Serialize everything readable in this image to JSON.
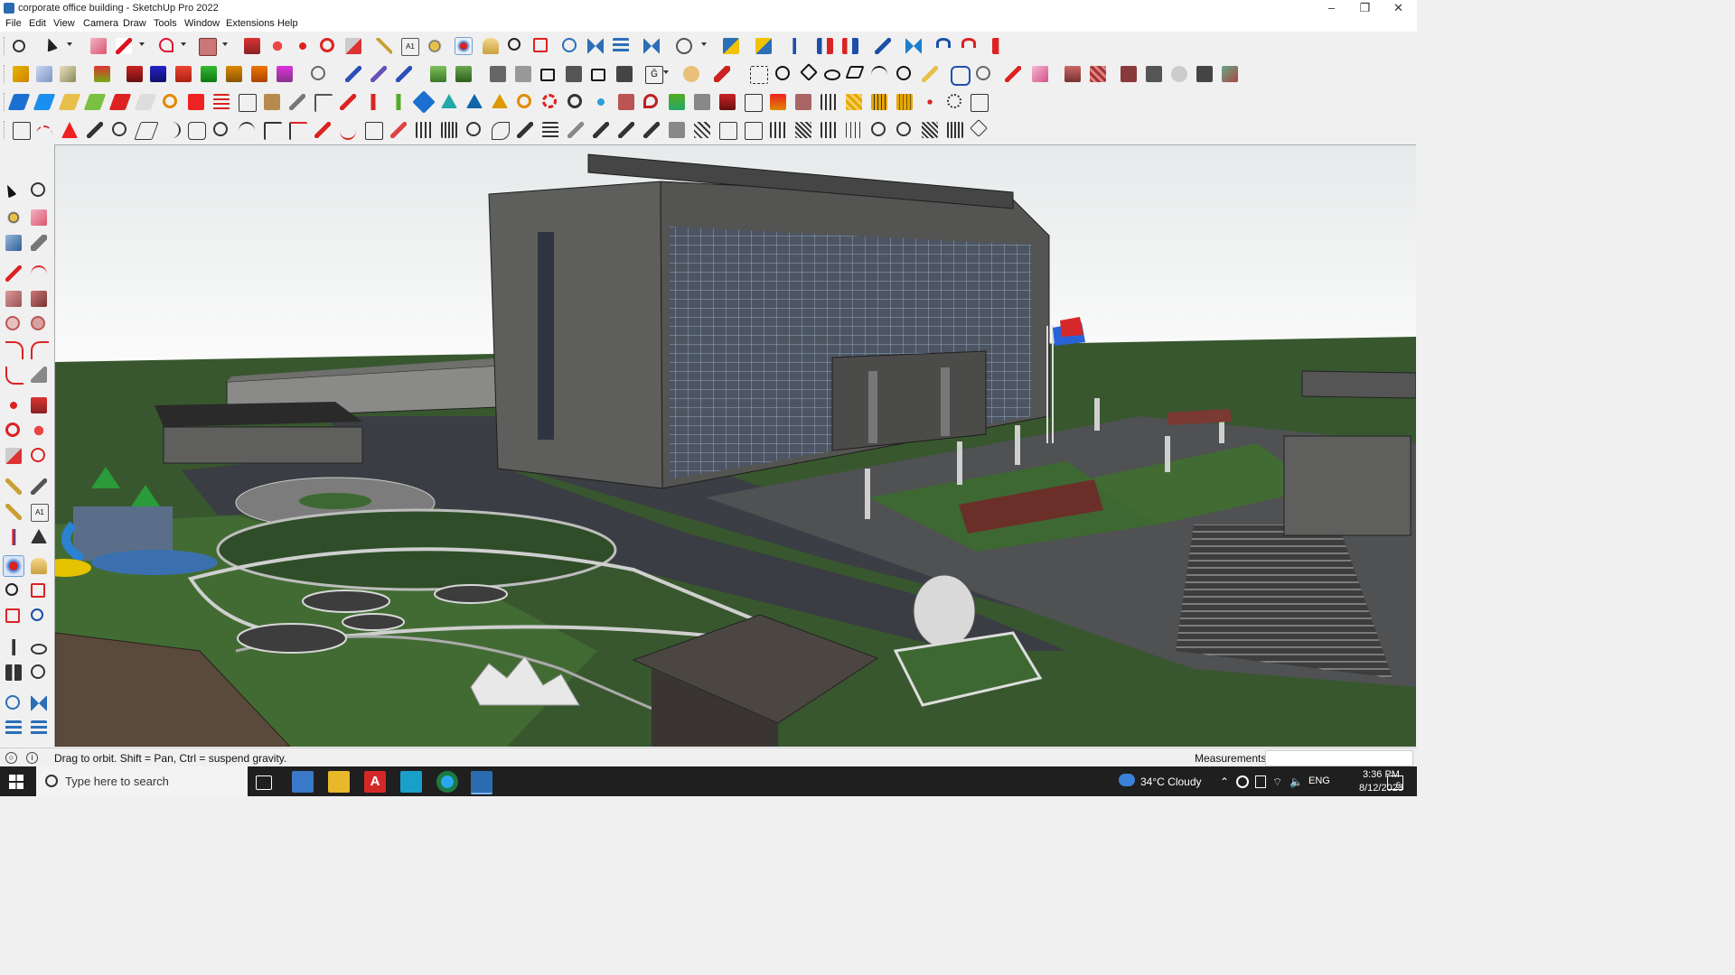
{
  "window": {
    "title": "corporate office building - SketchUp Pro 2022",
    "minimize": "–",
    "maximize": "❐",
    "close": "✕"
  },
  "menu": [
    "File",
    "Edit",
    "View",
    "Camera",
    "Draw",
    "Tools",
    "Window",
    "Extensions",
    "Help"
  ],
  "status": {
    "hint": "Drag to orbit. Shift = Pan, Ctrl = suspend gravity.",
    "measurements_label": "Measurements",
    "measurements_value": ""
  },
  "taskbar": {
    "search_placeholder": "Type here to search",
    "weather": "34°C  Cloudy",
    "language": "ENG",
    "time": "3:36 PM",
    "date": "8/12/2023",
    "notification_count": "5"
  },
  "colors": {
    "sky_top": "#e6eaea",
    "grass": "#3a5a30",
    "road": "#3b3e44",
    "building": "#5e5e5c",
    "flag_red": "#d62828",
    "flag_blue": "#2a62d8",
    "toolbar_bg": "#f0f0f0",
    "taskbar_bg": "#1f1f1f"
  },
  "icons": {
    "toolbar_row1": [
      "zoom-window-icon",
      "select-icon",
      "eraser-icon",
      "line-icon",
      "freehand-arc-icon",
      "rectangle-icon",
      "push-pull-icon",
      "follow-me-icon",
      "move-icon",
      "rotate-icon",
      "scale-icon",
      "tape-measure-icon",
      "text-icon",
      "paint-bucket-icon",
      "orbit-icon",
      "pan-icon",
      "zoom-icon",
      "zoom-extents-icon",
      "warehouse-icon",
      "extension-warehouse-icon",
      "layout-icon",
      "style-builder-icon",
      "account-icon",
      "section-plane-icon",
      "section-cut-icon",
      "axes-icon",
      "intersect-icon",
      "dimensions-icon",
      "undo-icon",
      "redo-icon",
      "fix-icon"
    ],
    "left_toolbar": [
      "select-icon",
      "orbit-icon",
      "paint-bucket-icon",
      "eraser-icon",
      "component-icon",
      "tag-icon",
      "line-icon",
      "freehand-icon",
      "rectangle-icon",
      "rotated-rectangle-icon",
      "circle-icon",
      "polygon-icon",
      "arc-icon",
      "pie-icon",
      "two-point-arc-icon",
      "three-point-arc-icon",
      "move-icon",
      "push-pull-icon",
      "rotate-icon",
      "follow-me-icon",
      "scale-icon",
      "offset-icon",
      "tape-measure-icon",
      "text-icon",
      "protractor-icon",
      "dimension-icon",
      "axes-icon",
      "3d-text-icon",
      "orbit-icon",
      "pan-icon",
      "zoom-icon",
      "zoom-window-icon",
      "zoom-extents-icon",
      "previous-view-icon",
      "position-camera-icon",
      "look-around-icon",
      "walk-icon",
      "section-plane-icon",
      "warehouse-icon",
      "share-model-icon",
      "layer-icon",
      "extension-icon"
    ]
  }
}
